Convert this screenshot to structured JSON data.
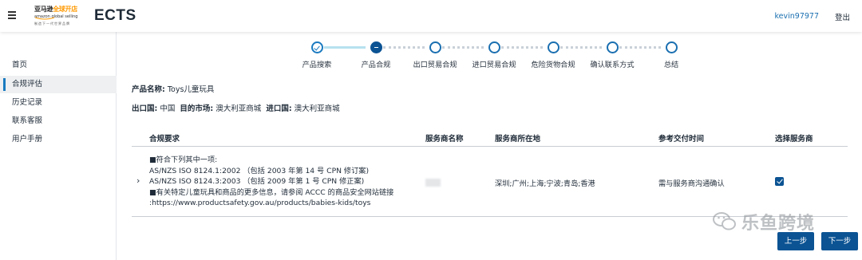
{
  "header": {
    "logo": {
      "brand_cn": "亚马逊",
      "brand_accent": "全球开店",
      "brand_en": "amazon global selling",
      "slogan": "制造下一代世界品牌"
    },
    "app_title": "ECTS",
    "username": "kevin97977",
    "logout_label": "登出"
  },
  "sidebar": {
    "items": [
      {
        "label": "首页",
        "active": false
      },
      {
        "label": "合规评估",
        "active": true
      },
      {
        "label": "历史记录",
        "active": false
      },
      {
        "label": "联系客服",
        "active": false
      },
      {
        "label": "用户手册",
        "active": false
      }
    ]
  },
  "stepper": {
    "steps": [
      {
        "label": "产品搜索",
        "state": "done"
      },
      {
        "label": "产品合规",
        "state": "current"
      },
      {
        "label": "出口贸易合规",
        "state": "pending"
      },
      {
        "label": "进口贸易合规",
        "state": "pending"
      },
      {
        "label": "危险货物合规",
        "state": "pending"
      },
      {
        "label": "确认联系方式",
        "state": "pending"
      },
      {
        "label": "总结",
        "state": "pending"
      }
    ]
  },
  "product": {
    "name_label": "产品名称:",
    "name_value": "Toys儿童玩具",
    "export_label": "出口国:",
    "export_value": "中国",
    "market_label": "目的市场:",
    "market_value": "澳大利亚商城",
    "import_label": "进口国:",
    "import_value": "澳大利亚商城"
  },
  "table": {
    "headers": [
      "合规要求",
      "服务商名称",
      "服务商所在地",
      "参考交付时间",
      "选择服务商"
    ],
    "rows": [
      {
        "requirement_lines": [
          "■符合下列其中一项:",
          "AS/NZS ISO 8124.1:2002 （包括 2003 年第 14 号 CPN 修订案)",
          "AS/NZS ISO 8124.3:2003 （包括 2009 年第 1 号 CPN 修正案)",
          "■有关特定儿童玩具和商品的更多信息，请参阅 ACCC 的商品安全网站链接",
          ":https://www.productsafety.gov.au/products/babies-kids/toys"
        ],
        "provider_name": "",
        "provider_location": "深圳;广州;上海;宁波;青岛;香港",
        "delivery_time": "需与服务商沟通确认",
        "selected": true
      }
    ]
  },
  "watermark": {
    "text": "乐鱼跨境",
    "icon": "wechat-icon"
  },
  "buttons": {
    "prev_label": "上一步",
    "next_label": "下一步"
  },
  "colors": {
    "primary": "#0b5393",
    "link": "#1a6fb0",
    "step_done_line": "#b7e1ef",
    "brand_orange": "#ff9900"
  }
}
